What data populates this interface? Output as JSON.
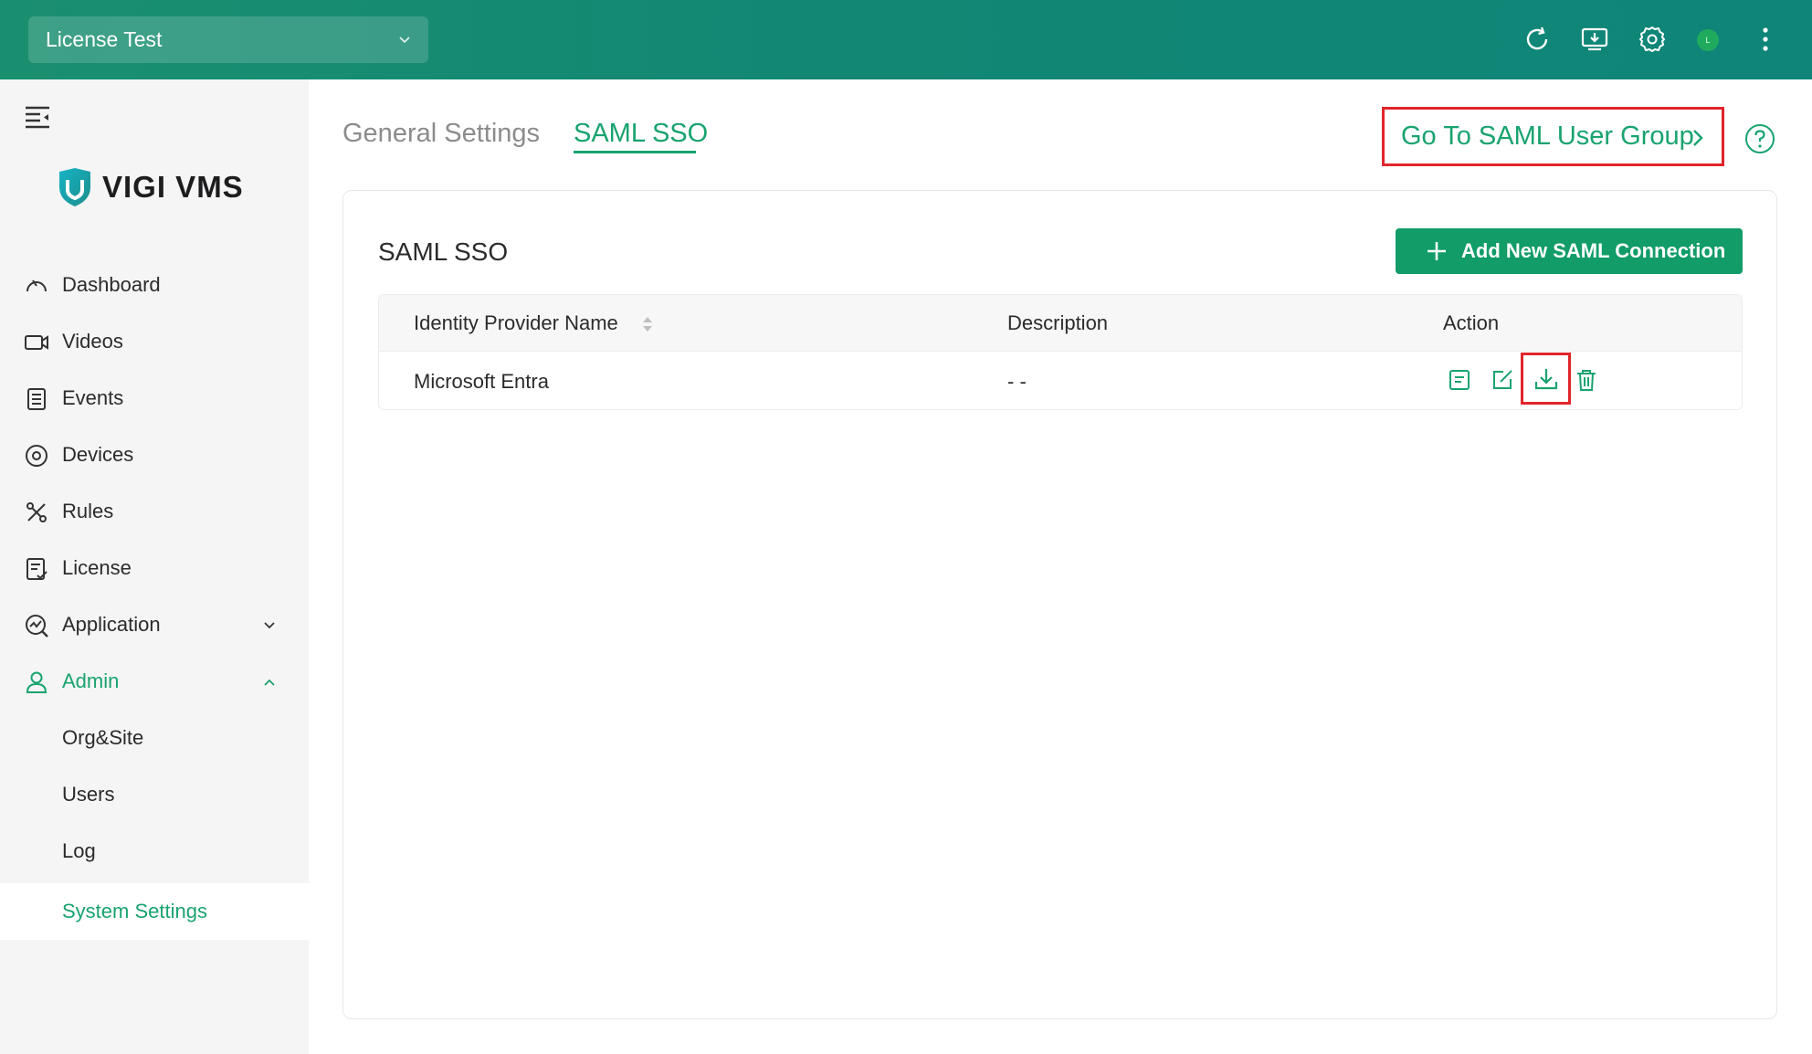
{
  "topbar": {
    "org_selector": "License Test",
    "avatar_initial": "L"
  },
  "sidebar": {
    "logo": "VIGI VMS",
    "nav": [
      {
        "label": "Dashboard",
        "icon": "dashboard-icon"
      },
      {
        "label": "Videos",
        "icon": "video-icon"
      },
      {
        "label": "Events",
        "icon": "events-icon"
      },
      {
        "label": "Devices",
        "icon": "devices-icon"
      },
      {
        "label": "Rules",
        "icon": "rules-icon"
      },
      {
        "label": "License",
        "icon": "license-icon"
      },
      {
        "label": "Application",
        "icon": "application-icon"
      },
      {
        "label": "Admin",
        "icon": "admin-icon"
      }
    ],
    "admin_sub": [
      {
        "label": "Org&Site"
      },
      {
        "label": "Users"
      },
      {
        "label": "Log"
      },
      {
        "label": "System Settings"
      }
    ]
  },
  "main": {
    "tabs": [
      {
        "label": "General Settings"
      },
      {
        "label": "SAML SSO"
      }
    ],
    "goto_link": "Go To SAML User Group",
    "card_title": "SAML SSO",
    "add_button": "Add New SAML Connection",
    "table": {
      "headers": [
        "Identity Provider Name",
        "Description",
        "Action"
      ],
      "rows": [
        {
          "name": "Microsoft Entra",
          "description": "- -"
        }
      ]
    }
  },
  "colors": {
    "accent": "#19a36f",
    "topbar": "#128774",
    "highlight": "#e0252b"
  }
}
